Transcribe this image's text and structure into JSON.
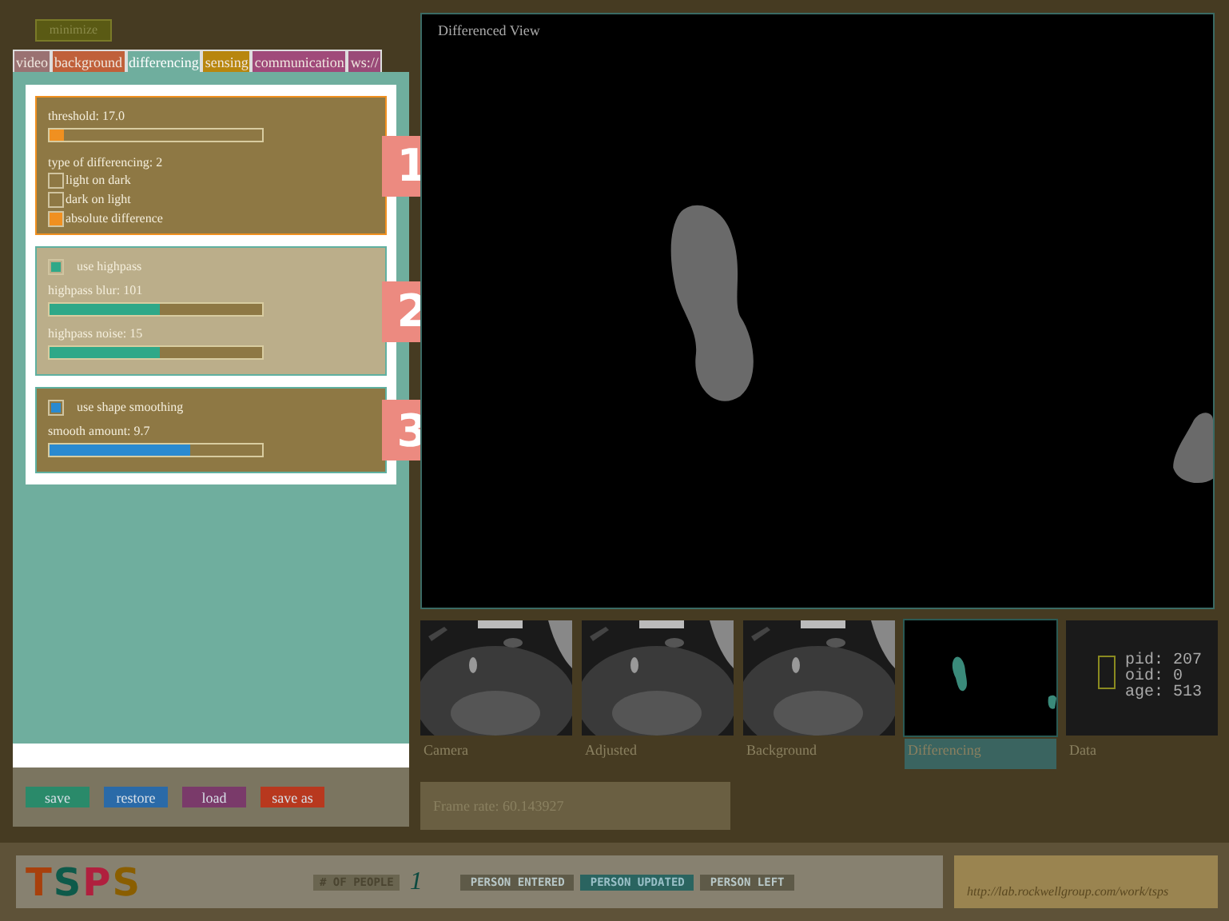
{
  "minimize_button": "minimize",
  "tabs": [
    {
      "label": "video",
      "color": "#9a7272",
      "selected": false
    },
    {
      "label": "background",
      "color": "#c0603a",
      "selected": false
    },
    {
      "label": "differencing",
      "color": "#6fae9e",
      "selected": true
    },
    {
      "label": "sensing",
      "color": "#b8860e",
      "selected": false
    },
    {
      "label": "communication",
      "color": "#a04a7a",
      "selected": false
    },
    {
      "label": "ws://",
      "color": "#9a4a78",
      "selected": false
    }
  ],
  "sections": [
    {
      "number": "1",
      "color": "#f09020",
      "highlighted": false,
      "controls": [
        {
          "kind": "slider",
          "label": "threshold: 17.0",
          "level": 0.07
        },
        {
          "kind": "heading",
          "label": "type of differencing: 2"
        },
        {
          "kind": "option",
          "label": "light on dark",
          "checked": false
        },
        {
          "kind": "option",
          "label": "dark on light",
          "checked": false
        },
        {
          "kind": "option",
          "label": "absolute difference",
          "checked": true
        }
      ]
    },
    {
      "number": "2",
      "color": "#2fa888",
      "highlighted": true,
      "controls": [
        {
          "kind": "toggle",
          "label": "use highpass",
          "checked": true
        },
        {
          "kind": "slider",
          "label": "highpass blur: 101",
          "level": 0.52
        },
        {
          "kind": "slider",
          "label": "highpass noise: 15",
          "level": 0.52
        }
      ]
    },
    {
      "number": "3",
      "color": "#2a8ad0",
      "highlighted": false,
      "controls": [
        {
          "kind": "toggle",
          "label": "use shape smoothing",
          "checked": true
        },
        {
          "kind": "slider",
          "label": "smooth amount: 9.7",
          "level": 0.66
        }
      ]
    }
  ],
  "buttons": [
    {
      "label": "save",
      "color": "#2a8a6a"
    },
    {
      "label": "restore",
      "color": "#2a6aa8"
    },
    {
      "label": "load",
      "color": "#7a3a6a"
    },
    {
      "label": "save as",
      "color": "#b8381e"
    }
  ],
  "main_view": {
    "title": "Differenced View"
  },
  "thumbnails": [
    {
      "label": "Camera",
      "kind": "picture",
      "selected": false
    },
    {
      "label": "Adjusted",
      "kind": "picture",
      "selected": false
    },
    {
      "label": "Background",
      "kind": "picture",
      "selected": false
    },
    {
      "label": "Differencing",
      "kind": "picture",
      "selected": true
    },
    {
      "label": "Data",
      "kind": "data",
      "lines": [
        "pid: 207",
        "oid: 0",
        "age: 513"
      ],
      "selected": false
    }
  ],
  "frame_rate": "Frame rate: 60.143927",
  "logo": "TSPS",
  "people_count": {
    "label": "# OF PEOPLE",
    "value": "1"
  },
  "events": [
    {
      "label": "PERSON ENTERED",
      "on": false
    },
    {
      "label": "PERSON UPDATED",
      "on": true
    },
    {
      "label": "PERSON LEFT",
      "on": false
    }
  ],
  "url": "http://lab.rockwellgroup.com/work/tsps"
}
